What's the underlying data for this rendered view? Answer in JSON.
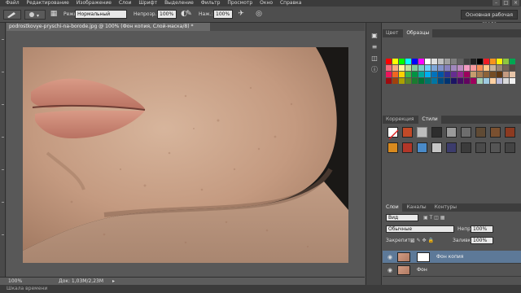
{
  "menu": {
    "items": [
      "Файл",
      "Редактирование",
      "Изображение",
      "Слои",
      "Шрифт",
      "Выделение",
      "Фильтр",
      "Просмотр",
      "Окно",
      "Справка"
    ]
  },
  "window_controls": {
    "minimize": "–",
    "maximize": "□",
    "close": "×"
  },
  "options_bar": {
    "mode_label": "Режим:",
    "mode_value": "Нормальный",
    "opacity_label": "Непрозр.:",
    "opacity_value": "100%",
    "pressure_label": "Наж.:",
    "pressure_value": "100%",
    "workspace_button": "Основная рабочая среда"
  },
  "document": {
    "tab_title": "podrostkovye-pryschi-na-borode.jpg @ 100% (Фон копия, Слой-маска/8) *"
  },
  "status": {
    "zoom": "100%",
    "doc_info": "Док: 1,03M/2,23M",
    "bottom_label": "Шкала времени"
  },
  "panels": {
    "color_tab": "Цвет",
    "swatches_tab": "Образцы",
    "adjustments_tab": "Коррекция",
    "styles_tab": "Стили",
    "layers_tab": "Слои",
    "channels_tab": "Каналы",
    "paths_tab": "Контуры"
  },
  "layers": {
    "filter_label": "Вид",
    "blend_mode": "Обычные",
    "opacity_label": "Непр:",
    "opacity_value": "100%",
    "lock_label": "Закрепить:",
    "fill_label": "Заливка:",
    "fill_value": "100%",
    "items": [
      {
        "name": "Фон копия",
        "selected": true
      },
      {
        "name": "Фон",
        "selected": false
      }
    ]
  },
  "colors": {
    "accent": "#5d7998",
    "skin": "#c49a80",
    "lip": "#c97f6c"
  }
}
